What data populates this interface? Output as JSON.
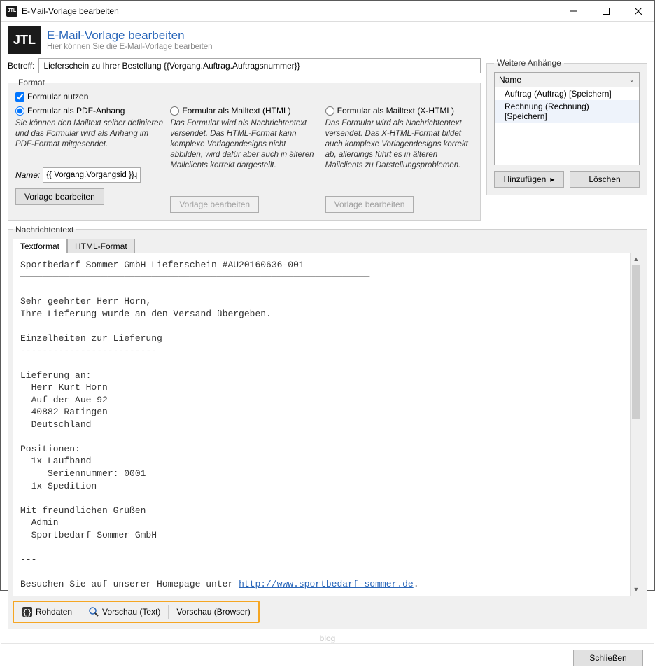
{
  "titlebar": {
    "title": "E-Mail-Vorlage bearbeiten",
    "app_abbrev": "JTL"
  },
  "header": {
    "logo": "JTL",
    "title": "E-Mail-Vorlage bearbeiten",
    "subtitle": "Hier können Sie die E-Mail-Vorlage bearbeiten"
  },
  "subject": {
    "label": "Betreff:",
    "value": "Lieferschein zu Ihrer Bestellung {{Vorgang.Auftrag.Auftragsnummer}}"
  },
  "format": {
    "legend": "Format",
    "checkbox_label": "Formular nutzen",
    "cols": {
      "pdf": {
        "radio": "Formular als PDF-Anhang",
        "desc": "Sie können den Mailtext selber definieren und das Formular wird als Anhang im PDF-Format mitgesendet.",
        "name_label": "Name:",
        "name_value": "{{ Vorgang.Vorgangsid }}.pdf",
        "button": "Vorlage bearbeiten"
      },
      "html": {
        "radio": "Formular als Mailtext (HTML)",
        "desc": "Das Formular wird als Nachrichtentext versendet. Das HTML-Format kann komplexe Vorlagendesigns nicht abbilden, wird dafür aber auch in älteren Mailclients korrekt dargestellt.",
        "button": "Vorlage bearbeiten"
      },
      "xhtml": {
        "radio": "Formular als Mailtext (X-HTML)",
        "desc": "Das Formular wird als Nachrichtentext versendet. Das X-HTML-Format bildet auch komplexe Vorlagendesigns korrekt ab, allerdings führt es in älteren Mailclients zu Darstellungsproblemen.",
        "button": "Vorlage bearbeiten"
      }
    }
  },
  "attachments": {
    "legend": "Weitere Anhänge",
    "header": "Name",
    "items": [
      "Auftrag (Auftrag) [Speichern]",
      "Rechnung (Rechnung) [Speichern]"
    ],
    "add": "Hinzufügen",
    "delete": "Löschen"
  },
  "message": {
    "legend": "Nachrichtentext",
    "tabs": [
      "Textformat",
      "HTML-Format"
    ],
    "line1": "Sportbedarf Sommer GmbH Lieferschein #AU20160636-001",
    "line2": "────────────────────────────────────────────────────────────────",
    "line3": "",
    "line4": "Sehr geehrter Herr Horn,",
    "line5": "Ihre Lieferung wurde an den Versand übergeben.",
    "line6": "",
    "line7": "Einzelheiten zur Lieferung",
    "line8": "-------------------------",
    "line9": "",
    "line10": "Lieferung an:",
    "line11": "  Herr Kurt Horn",
    "line12": "  Auf der Aue 92",
    "line13": "  40882 Ratingen",
    "line14": "  Deutschland",
    "line15": "",
    "line16": "Positionen:",
    "line17": "  1x Laufband",
    "line18": "     Seriennummer: 0001",
    "line19": "  1x Spedition",
    "line20": "",
    "line21": "Mit freundlichen Grüßen",
    "line22": "  Admin",
    "line23": "  Sportbedarf Sommer GmbH",
    "line24": "",
    "line25": "---",
    "line26": "",
    "line27_a": "Besuchen Sie auf unserer Homepage unter ",
    "line27_b": "http://www.sportbedarf-sommer.de",
    "line27_c": "."
  },
  "toolbar": {
    "raw": "Rohdaten",
    "preview_text": "Vorschau (Text)",
    "preview_browser": "Vorschau (Browser)"
  },
  "footer": {
    "blog": "blog",
    "close": "Schließen"
  }
}
